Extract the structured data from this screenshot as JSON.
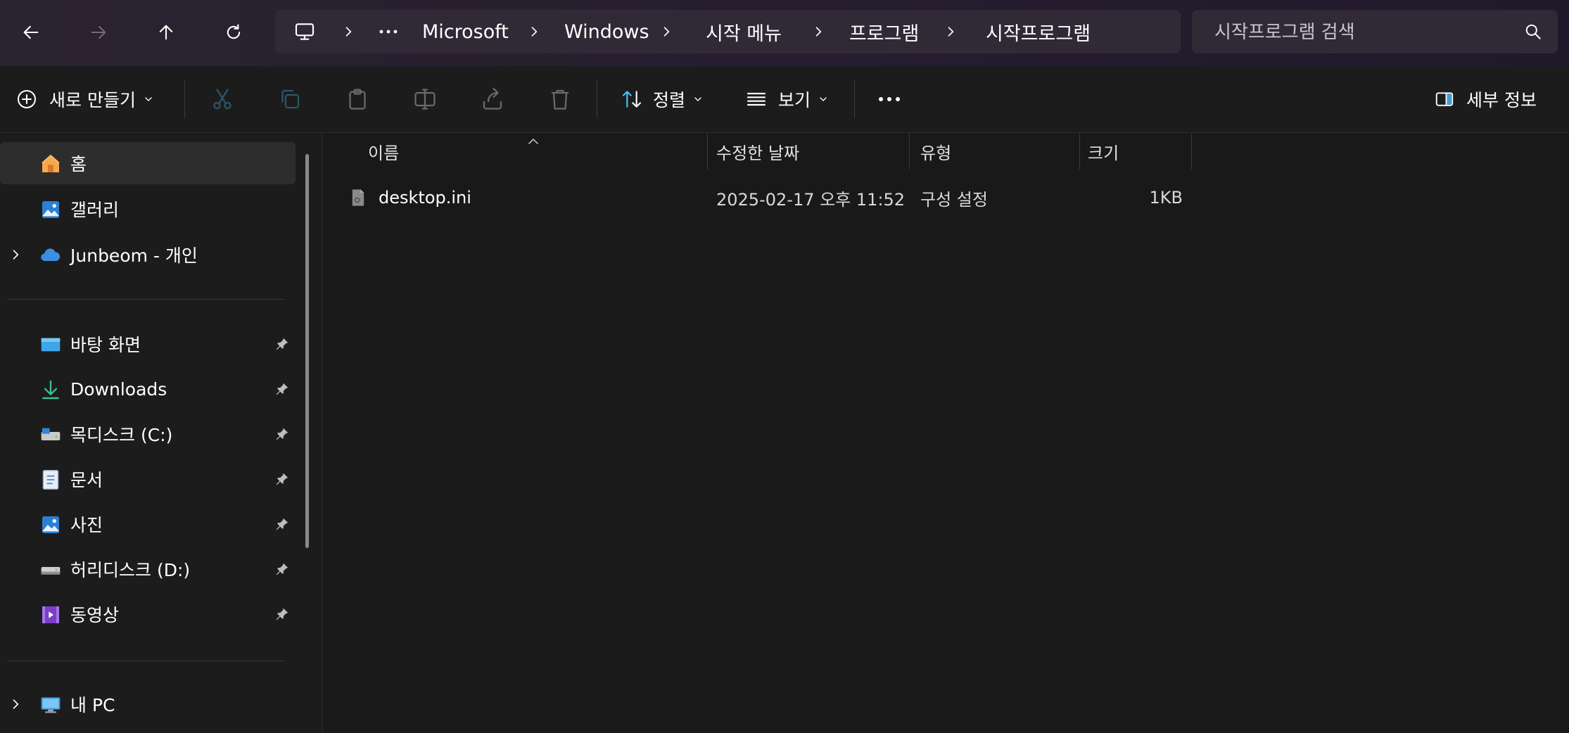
{
  "breadcrumb": {
    "items": [
      "Microsoft",
      "Windows",
      "시작 메뉴",
      "프로그램",
      "시작프로그램"
    ]
  },
  "search": {
    "placeholder": "시작프로그램 검색"
  },
  "toolbar": {
    "new_label": "새로 만들기",
    "sort_label": "정렬",
    "view_label": "보기",
    "details_label": "세부 정보"
  },
  "sidebar": {
    "quick": [
      {
        "label": "홈",
        "icon": "home-icon"
      },
      {
        "label": "갤러리",
        "icon": "gallery-icon"
      },
      {
        "label": "Junbeom - 개인",
        "icon": "onedrive-cloud-icon"
      }
    ],
    "pinned": [
      {
        "label": "바탕 화면",
        "icon": "desktop-folder-icon"
      },
      {
        "label": "Downloads",
        "icon": "download-icon"
      },
      {
        "label": "목디스크 (C:)",
        "icon": "drive-c-icon"
      },
      {
        "label": "문서",
        "icon": "documents-icon"
      },
      {
        "label": "사진",
        "icon": "pictures-icon"
      },
      {
        "label": "허리디스크 (D:)",
        "icon": "drive-d-icon"
      },
      {
        "label": "동영상",
        "icon": "videos-icon"
      }
    ],
    "this_pc": {
      "label": "내 PC",
      "icon": "this-pc-icon"
    }
  },
  "columns": {
    "name": "이름",
    "modified": "수정한 날짜",
    "type": "유형",
    "size": "크기"
  },
  "files": [
    {
      "name": "desktop.ini",
      "modified": "2025-02-17 오후 11:52",
      "type": "구성 설정",
      "size": "1KB"
    }
  ],
  "colors": {
    "accent": "#4cc2ff",
    "background": "#191919",
    "titlebar": "#261e2f"
  }
}
